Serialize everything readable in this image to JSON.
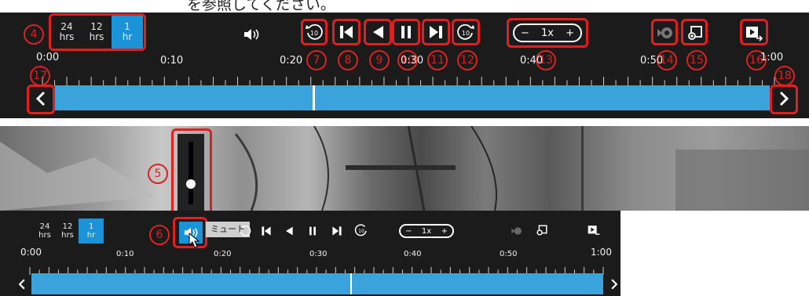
{
  "caption": {
    "text": "を参照してください。"
  },
  "top": {
    "ranges": [
      {
        "value": "24",
        "unit": "hrs"
      },
      {
        "value": "12",
        "unit": "hrs"
      },
      {
        "value": "1",
        "unit": "hr",
        "active": true
      }
    ],
    "speed": {
      "minus": "−",
      "label": "1x",
      "plus": "+"
    },
    "times": [
      "0:00",
      "0:10",
      "0:20",
      "0:30",
      "0:40",
      "0:50",
      "1:00"
    ],
    "callouts": {
      "range": "4",
      "rew10": "7",
      "start": "8",
      "back": "9",
      "pause": "10",
      "end": "11",
      "fwd10": "12",
      "speed": "13",
      "camera": "14",
      "export": "15",
      "exit": "16",
      "left": "17",
      "right": "18"
    }
  },
  "video": {
    "callout_volume": "5",
    "volume_level": 0.5
  },
  "bottom": {
    "ranges": [
      {
        "value": "24",
        "unit": "hrs"
      },
      {
        "value": "12",
        "unit": "hrs"
      },
      {
        "value": "1",
        "unit": "hr",
        "active": true
      }
    ],
    "tooltip": "ミュート",
    "callout_volume": "6",
    "speed": {
      "minus": "−",
      "label": "1x",
      "plus": "+"
    },
    "times": [
      "0:00",
      "0:10",
      "0:20",
      "0:30",
      "0:40",
      "0:50",
      "1:00"
    ]
  },
  "colors": {
    "accent": "#1a93d8",
    "callout": "#e02020",
    "panel": "#1b1b1b"
  },
  "icons": [
    "speaker-icon",
    "rewind-10-icon",
    "skip-start-icon",
    "step-back-icon",
    "pause-icon",
    "skip-end-icon",
    "forward-10-icon",
    "camera-icon",
    "snapshot-icon",
    "exit-playback-icon",
    "chevron-left-icon",
    "chevron-right-icon"
  ]
}
